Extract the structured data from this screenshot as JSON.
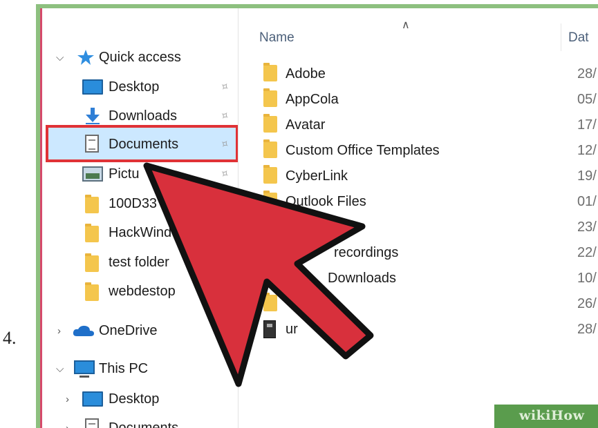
{
  "step": {
    "number": "4."
  },
  "nav": {
    "quick_access": "Quick access",
    "items": [
      {
        "label": "Desktop",
        "icon": "desktop-icon"
      },
      {
        "label": "Downloads",
        "icon": "download-arrow-icon"
      },
      {
        "label": "Documents",
        "icon": "document-icon"
      },
      {
        "label": "Pictu",
        "icon": "pictures-icon"
      },
      {
        "label": "100D33",
        "icon": "folder-icon"
      },
      {
        "label": "HackWind",
        "icon": "folder-icon"
      },
      {
        "label": "test folder",
        "icon": "folder-icon"
      },
      {
        "label": "webdestop",
        "icon": "folder-icon"
      }
    ],
    "onedrive": "OneDrive",
    "this_pc": "This PC",
    "this_pc_items": [
      {
        "label": "Desktop",
        "icon": "desktop-icon"
      },
      {
        "label": "Documents",
        "icon": "document-icon"
      }
    ]
  },
  "content": {
    "columns": {
      "name": "Name",
      "date": "Dat"
    },
    "files": [
      {
        "name": "Adobe",
        "date": "28/",
        "icon": "folder-icon"
      },
      {
        "name": "AppCola",
        "date": "05/",
        "icon": "folder-icon"
      },
      {
        "name": "Avatar",
        "date": "17/",
        "icon": "folder-icon"
      },
      {
        "name": "Custom Office Templates",
        "date": "12/",
        "icon": "folder-icon"
      },
      {
        "name": "CyberLink",
        "date": "19/",
        "icon": "folder-icon"
      },
      {
        "name": "Outlook Files",
        "date": "01/",
        "icon": "folder-icon"
      },
      {
        "name": "",
        "date": "23/",
        "icon": "folder-icon"
      },
      {
        "name": "recordings",
        "date": "22/",
        "icon": "folder-icon"
      },
      {
        "name": "Downloads",
        "date": "10/",
        "icon": "folder-icon"
      },
      {
        "name": "",
        "date": "26/",
        "icon": "folder-icon"
      },
      {
        "name": "ur",
        "date": "28/",
        "icon": "file-icon"
      }
    ]
  },
  "colors": {
    "highlight_border": "#e03236",
    "arrow": "#d8303c",
    "selection": "#cce8ff",
    "frame": "#8dc07f"
  },
  "watermark": {
    "text": "wikiHow"
  }
}
